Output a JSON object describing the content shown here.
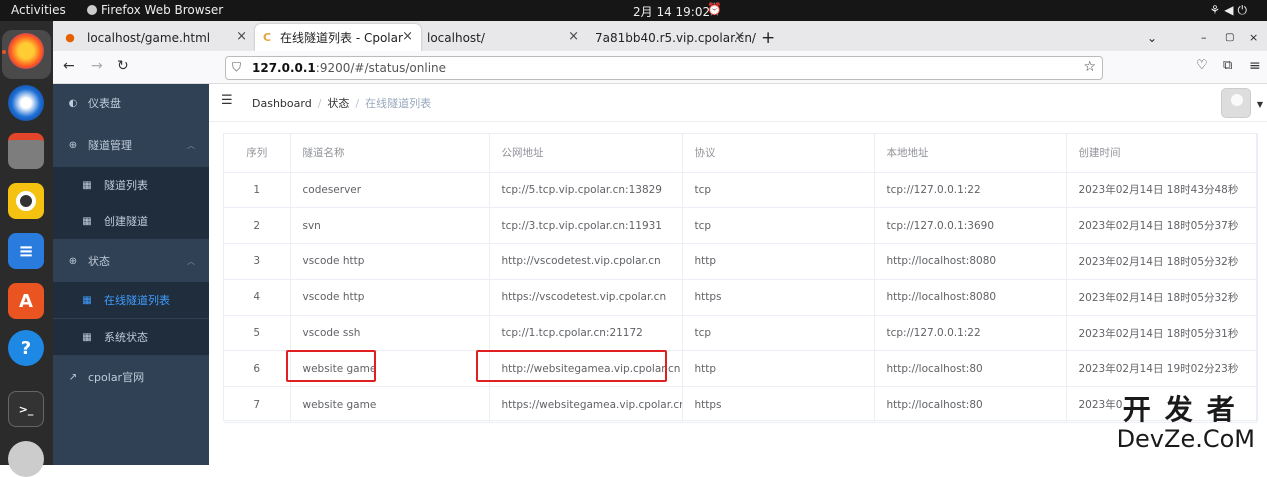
{
  "topbar": {
    "activities": "Activities",
    "app_name": "Firefox Web Browser",
    "clock": "2月 14  19:02"
  },
  "tabs": [
    {
      "label": "localhost/game.html",
      "icon": "firefox-icon"
    },
    {
      "label": "在线隧道列表 - Cpolar",
      "icon": "cpolar-icon"
    },
    {
      "label": "localhost/",
      "icon": ""
    },
    {
      "label": "7a81bb40.r5.vip.cpolar.cn/",
      "icon": ""
    }
  ],
  "url": {
    "host": "127.0.0.1",
    "rest": ":9200/#/status/online"
  },
  "sidebar": {
    "items": [
      {
        "label": "仪表盘"
      },
      {
        "label": "隧道管理"
      },
      {
        "label": "隧道列表"
      },
      {
        "label": "创建隧道"
      },
      {
        "label": "状态"
      },
      {
        "label": "在线隧道列表"
      },
      {
        "label": "系统状态"
      },
      {
        "label": "cpolar官网"
      }
    ]
  },
  "breadcrumb": {
    "home": "Dashboard",
    "parent": "状态",
    "current": "在线隧道列表"
  },
  "table": {
    "headers": [
      "序列",
      "隧道名称",
      "公网地址",
      "协议",
      "本地地址",
      "创建时间"
    ],
    "rows": [
      [
        "1",
        "codeserver",
        "tcp://5.tcp.vip.cpolar.cn:13829",
        "tcp",
        "tcp://127.0.0.1:22",
        "2023年02月14日 18时43分48秒"
      ],
      [
        "2",
        "svn",
        "tcp://3.tcp.vip.cpolar.cn:11931",
        "tcp",
        "tcp://127.0.0.1:3690",
        "2023年02月14日 18时05分37秒"
      ],
      [
        "3",
        "vscode http",
        "http://vscodetest.vip.cpolar.cn",
        "http",
        "http://localhost:8080",
        "2023年02月14日 18时05分32秒"
      ],
      [
        "4",
        "vscode http",
        "https://vscodetest.vip.cpolar.cn",
        "https",
        "http://localhost:8080",
        "2023年02月14日 18时05分32秒"
      ],
      [
        "5",
        "vscode ssh",
        "tcp://1.tcp.cpolar.cn:21172",
        "tcp",
        "tcp://127.0.0.1:22",
        "2023年02月14日 18时05分31秒"
      ],
      [
        "6",
        "website game",
        "http://websitegamea.vip.cpolar.cn",
        "http",
        "http://localhost:80",
        "2023年02月14日 19时02分23秒"
      ],
      [
        "7",
        "website game",
        "https://websitegamea.vip.cpolar.cn",
        "https",
        "http://localhost:80",
        "2023年0"
      ]
    ]
  },
  "watermark": {
    "cn": "开发者",
    "en": "DevZe.CoM"
  },
  "colors": {
    "sidebar": "#304156",
    "active": "#409eff",
    "highlight": "#e02020"
  }
}
